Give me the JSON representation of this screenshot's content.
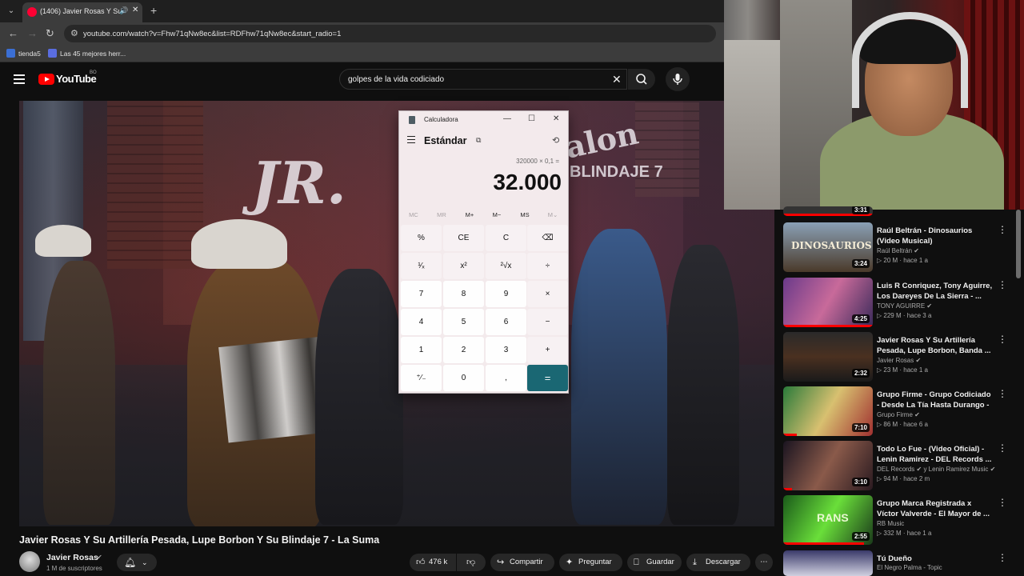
{
  "browser": {
    "tab_title": "(1406) Javier Rosas Y Su Artilleria",
    "url": "youtube.com/watch?v=Fhw71qNw8ec&list=RDFhw71qNw8ec&start_radio=1",
    "bookmarks": [
      "tienda5",
      "Las 45 mejores herr..."
    ]
  },
  "youtube": {
    "logo_text": "YouTube",
    "country": "BO",
    "search_value": "golpes de la vida codiciado"
  },
  "calculator": {
    "app_title": "Calculadora",
    "mode": "Estándar",
    "expression": "320000 × 0,1 =",
    "result": "32.000",
    "memory": [
      "MC",
      "MR",
      "M+",
      "M−",
      "MS",
      "M⌄"
    ],
    "keys": [
      [
        "%",
        "CE",
        "C",
        "⌫"
      ],
      [
        "¹⁄ₓ",
        "x²",
        "²√x",
        "÷"
      ],
      [
        "7",
        "8",
        "9",
        "×"
      ],
      [
        "4",
        "5",
        "6",
        "−"
      ],
      [
        "1",
        "2",
        "3",
        "+"
      ],
      [
        "⁺⁄₋",
        "0",
        ",",
        "="
      ]
    ]
  },
  "video": {
    "title": "Javier Rosas Y Su Artillería Pesada, Lupe Borbon Y Su Blindaje 7 - La Suma",
    "channel": "Javier Rosas",
    "subscribers": "1 M de suscriptores",
    "likes": "476 k",
    "actions": [
      "Compartir",
      "Preguntar",
      "Guardar",
      "Descargar"
    ],
    "overlay_text": [
      "JR.",
      "Galon",
      "BLINDAJE 7"
    ]
  },
  "sidebar": {
    "top_partial_duration": "3:31",
    "items": [
      {
        "title": "Raúl Beltrán - Dinosaurios (Video Musical)",
        "channel": "Raúl Beltrán",
        "meta": "20 M · hace 1 a",
        "duration": "3:24",
        "thumb_text": "DINOSAURIOS",
        "progress": 0
      },
      {
        "title": "Luis R Conriquez, Tony Aguirre, Los Dareyes De La Sierra - ...",
        "channel": "TONY AGUIRRE",
        "meta": "229 M · hace 3 a",
        "duration": "4:25",
        "progress": 1.0
      },
      {
        "title": "Javier Rosas Y Su Artillería Pesada, Lupe Borbon, Banda ...",
        "channel": "Javier Rosas",
        "meta": "23 M · hace 1 a",
        "duration": "2:32",
        "progress": 0
      },
      {
        "title": "Grupo Firme - Grupo Codiciado - Desde La Tía Hasta Durango - ...",
        "channel": "Grupo Firme",
        "meta": "86 M · hace 6 a",
        "duration": "7:10",
        "progress": 0.15
      },
      {
        "title": "Todo Lo Fue - (Video Oficial) - Lenin Ramirez - DEL Records ...",
        "channel": "DEL Records",
        "channel_extra": "y Lenin Ramirez Music",
        "meta": "94 M · hace 2 m",
        "duration": "3:10",
        "progress": 0.1
      },
      {
        "title": "Grupo Marca Registrada x Víctor Valverde - El Mayor de ...",
        "channel": "RB Music",
        "meta": "332 M · hace 1 a",
        "duration": "2:55",
        "thumb_text": "RANS",
        "progress": 0.9
      },
      {
        "title": "Tú Dueño",
        "channel": "El Negro Palma - Topic",
        "meta": "",
        "duration": "",
        "progress": 0
      }
    ]
  },
  "colors": {
    "accent_red": "#ff0000",
    "calc_equals": "#1a6773",
    "bg": "#0f0f0f"
  }
}
